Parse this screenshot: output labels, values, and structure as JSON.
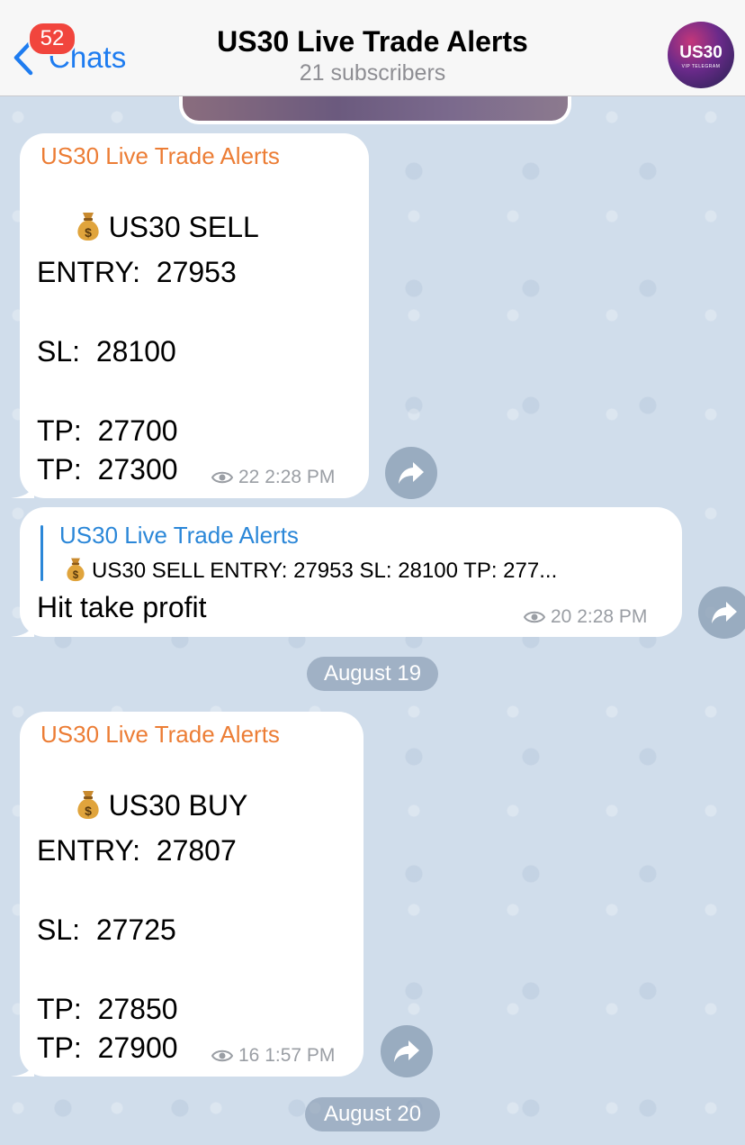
{
  "header": {
    "back_label": "Chats",
    "unread_badge": "52",
    "title": "US30 Live Trade Alerts",
    "subtitle": "21 subscribers",
    "avatar_text": "US30",
    "avatar_subtext": "VIP TELEGRAM"
  },
  "messages": [
    {
      "sender": "US30 Live Trade Alerts",
      "icon": "money-bag-icon",
      "lines": [
        "US30 SELL",
        "ENTRY:  27953",
        "SL:  28100",
        "TP:  27700",
        "TP:  27300"
      ],
      "views": "22",
      "time": "2:28 PM"
    },
    {
      "reply_to_name": "US30 Live Trade Alerts",
      "reply_to_text": "US30 SELL ENTRY:  27953 SL:  28100 TP:  277...",
      "text": "Hit take profit",
      "views": "20",
      "time": "2:28 PM"
    },
    {
      "sender": "US30 Live Trade Alerts",
      "icon": "money-bag-icon",
      "lines": [
        "US30 BUY",
        "ENTRY:  27807",
        "SL:  27725",
        "TP:  27850",
        "TP:  27900"
      ],
      "views": "16",
      "time": "1:57 PM"
    }
  ],
  "date_separators": [
    "August 19",
    "August 20"
  ],
  "colors": {
    "accent": "#1e7cf0",
    "sender_name": "#ec7d35",
    "reply_accent": "#2b87d8",
    "badge": "#f1453d",
    "wallpaper": "#d2dfec"
  }
}
